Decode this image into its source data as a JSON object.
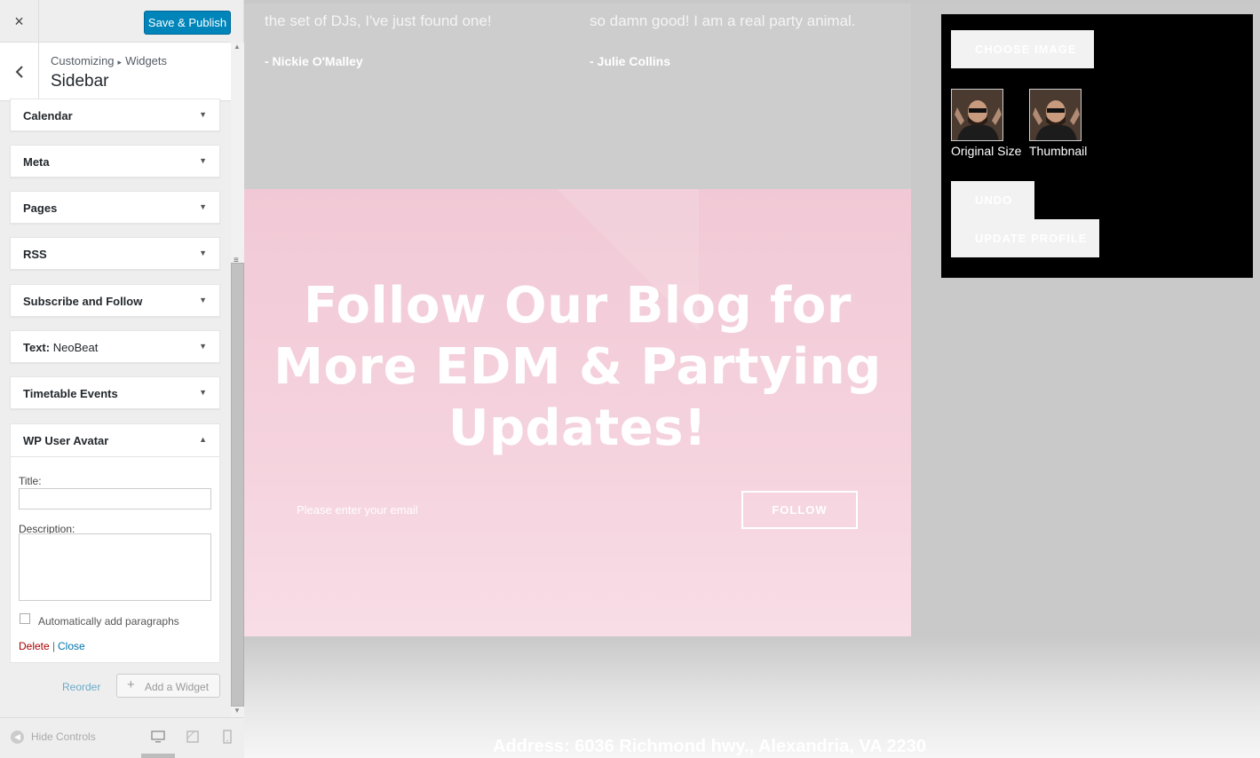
{
  "sidebar": {
    "close_icon": "×",
    "save_label": "Save & Publish",
    "breadcrumb": {
      "parent": "Customizing",
      "separator": "▸",
      "current": "Widgets"
    },
    "section_title": "Sidebar",
    "widgets": [
      {
        "label": "Calendar"
      },
      {
        "label": "Meta"
      },
      {
        "label": "Pages"
      },
      {
        "label": "RSS"
      },
      {
        "label": "Subscribe and Follow"
      },
      {
        "label": "Text:",
        "sublabel": "NeoBeat"
      },
      {
        "label": "Timetable Events"
      }
    ],
    "open_widget": {
      "label": "WP User Avatar",
      "title_label": "Title:",
      "title_value": "",
      "description_label": "Description:",
      "description_value": "",
      "autop_label": "Automatically add paragraphs",
      "autop_checked": false,
      "delete_label": "Delete",
      "divider": "|",
      "close_label": "Close"
    },
    "reorder_label": "Reorder",
    "add_widget_label": "Add a Widget",
    "add_widget_icon": "+",
    "hide_controls_label": "Hide Controls",
    "active_device": "desktop"
  },
  "preview": {
    "testimonials": [
      {
        "quote": "the set of DJs, I've just found one!",
        "author": "- Nickie O'Malley"
      },
      {
        "quote": "so damn good! I am a real party animal.",
        "author": "- Julie Collins"
      }
    ],
    "blog_heading": "Follow Our Blog for More EDM & Partying Updates!",
    "email_placeholder": "Please enter your email",
    "follow_label": "FOLLOW",
    "address": "Address: 6036 Richmond hwy., Alexandria, VA 2230"
  },
  "avatar_popup": {
    "choose_label": "CHOOSE IMAGE",
    "thumbs": [
      {
        "label": "Original Size"
      },
      {
        "label": "Thumbnail"
      }
    ],
    "undo_label": "UNDO",
    "update_label": "UPDATE PROFILE"
  },
  "colors": {
    "primary_button": "#0085ba",
    "blog_bg": "#f1c9d6",
    "delete_link": "#aa0000",
    "link": "#0073aa",
    "popup_bg": "#000000"
  }
}
